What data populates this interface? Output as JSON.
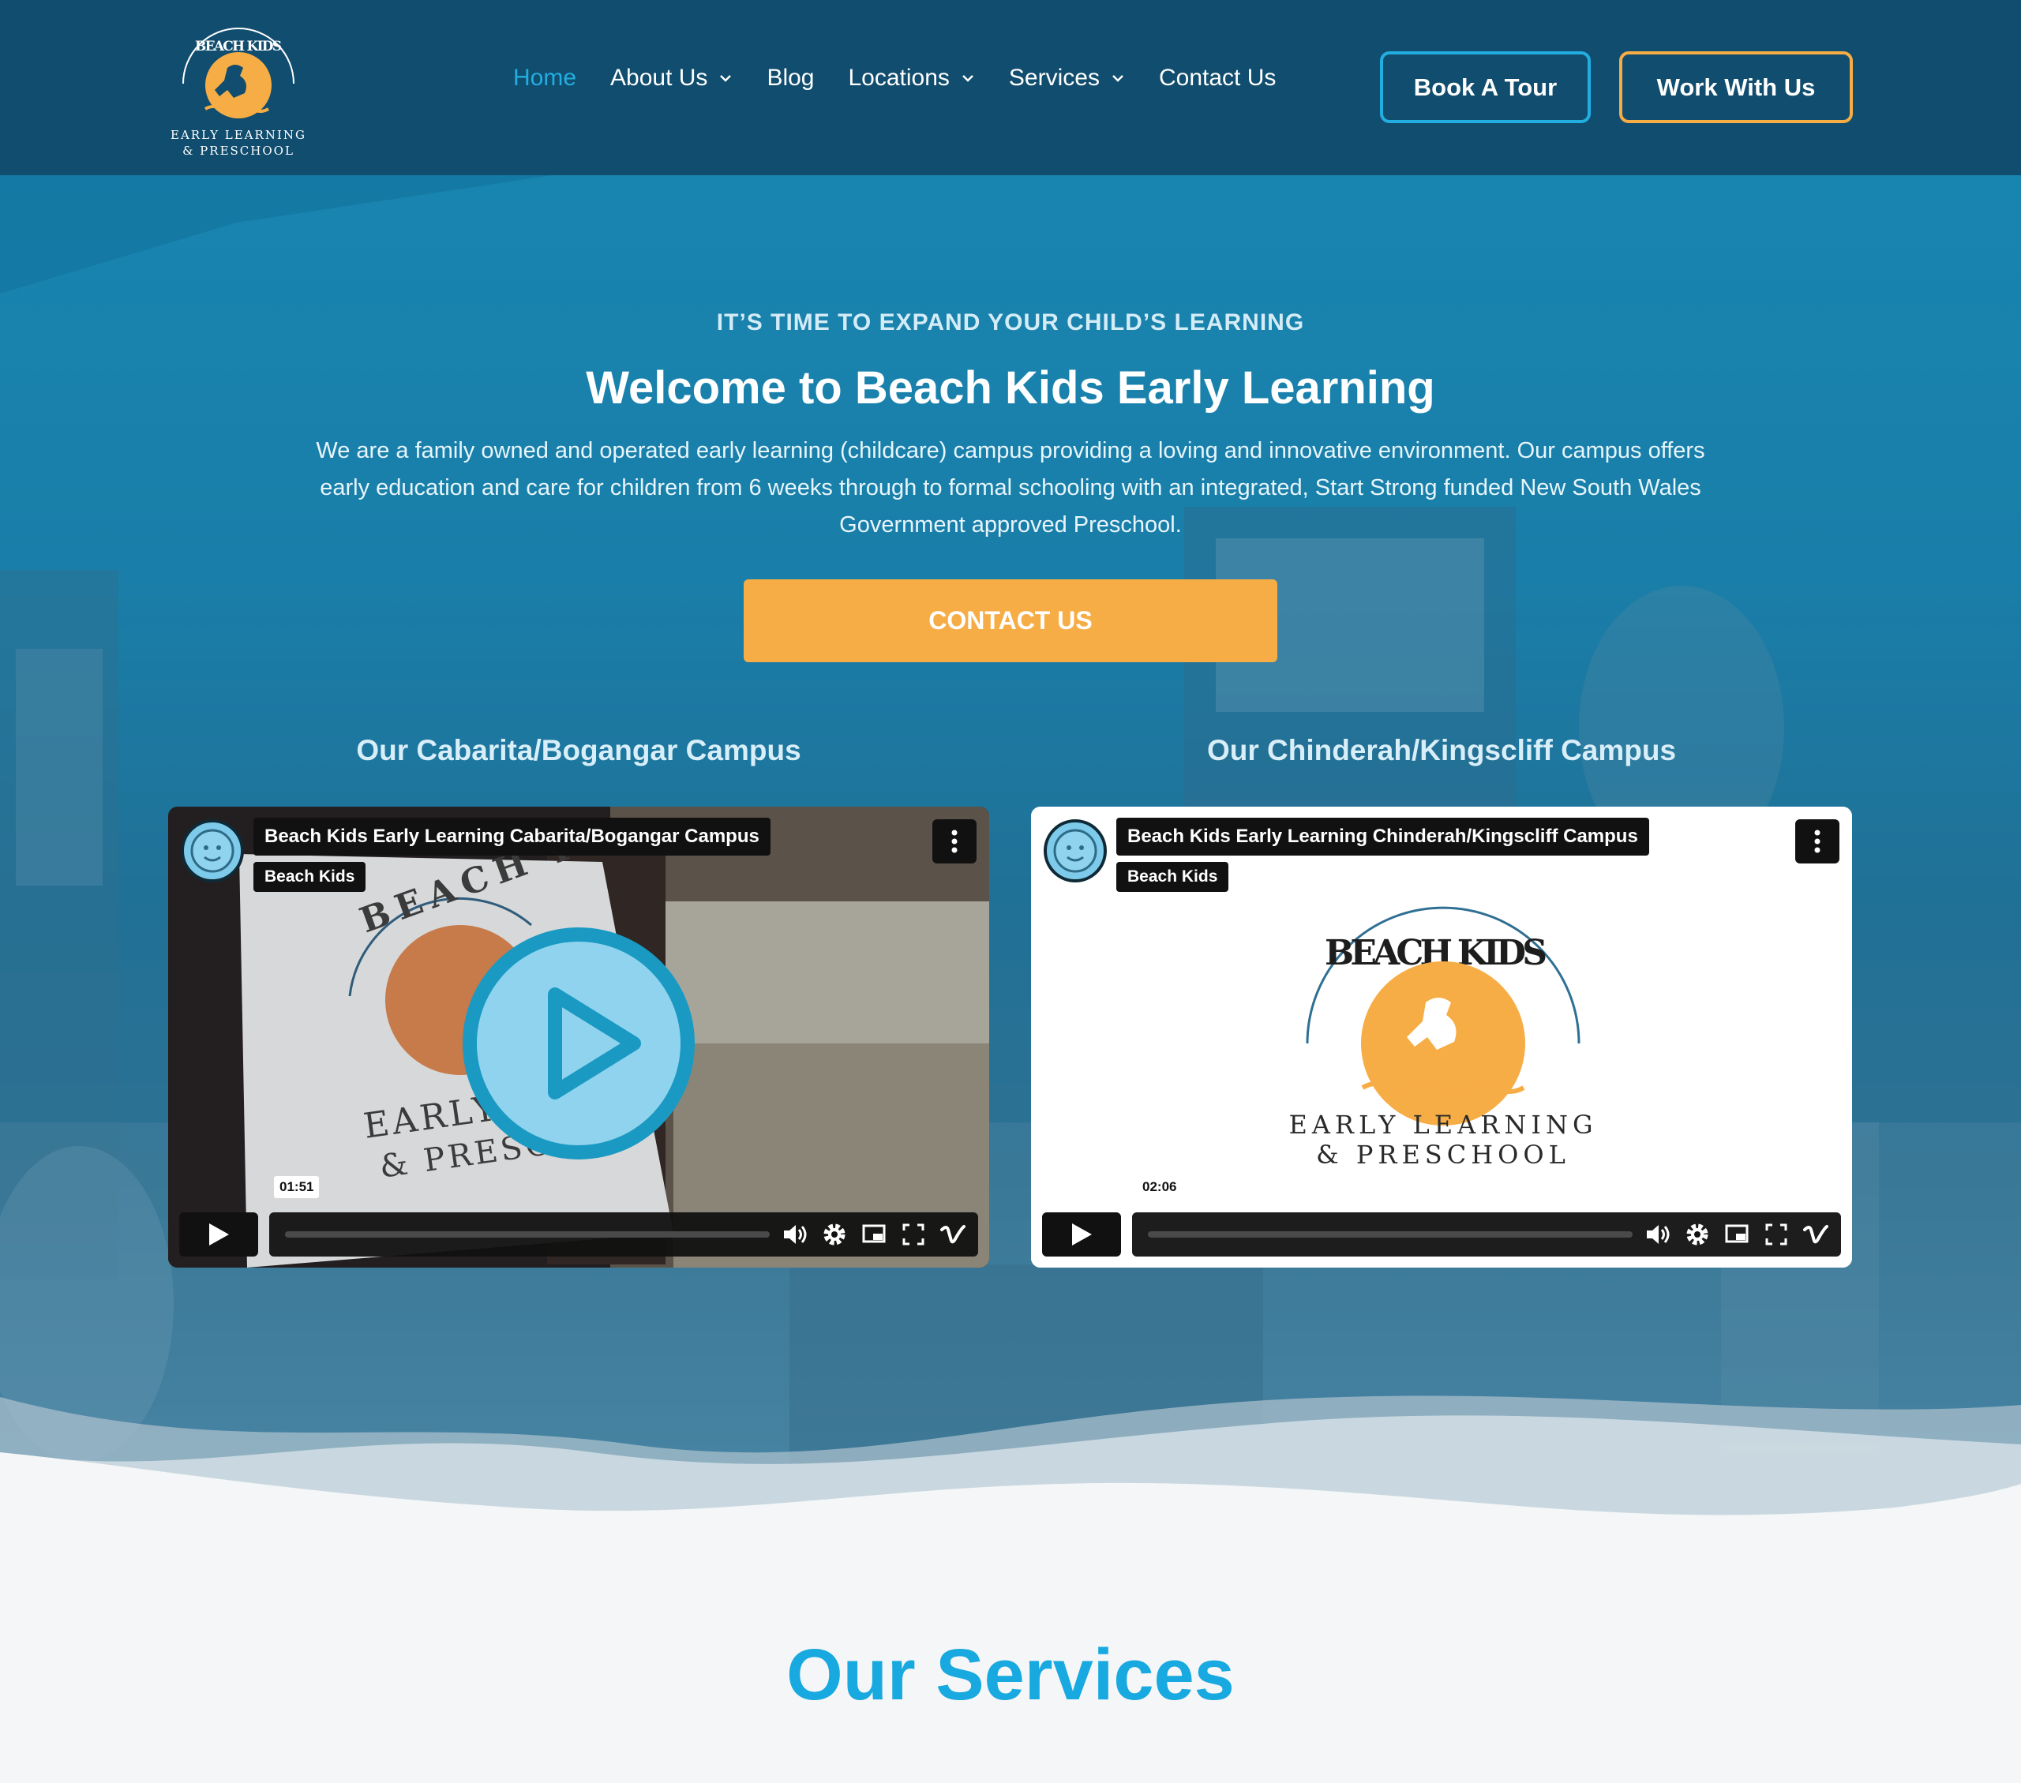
{
  "header": {
    "logo": {
      "arc_text": "BEACH KIDS",
      "line1": "EARLY LEARNING",
      "line2": "& PRESCHOOL"
    },
    "nav": [
      {
        "label": "Home",
        "active": true,
        "dropdown": false
      },
      {
        "label": "About Us",
        "active": false,
        "dropdown": true
      },
      {
        "label": "Blog",
        "active": false,
        "dropdown": false
      },
      {
        "label": "Locations",
        "active": false,
        "dropdown": true
      },
      {
        "label": "Services",
        "active": false,
        "dropdown": true
      },
      {
        "label": "Contact Us",
        "active": false,
        "dropdown": false
      }
    ],
    "book_tour_label": "Book A Tour",
    "work_with_us_label": "Work With Us"
  },
  "hero": {
    "eyebrow": "IT’S TIME TO EXPAND YOUR CHILD’S LEARNING",
    "title": "Welcome to Beach Kids Early Learning",
    "description": "We are a family owned and operated early learning (childcare) campus providing a loving and innovative environment. Our campus offers early education and care for children from 6 weeks through to formal schooling with an integrated, Start Strong funded New South Wales Government approved Preschool.",
    "cta_label": "CONTACT US"
  },
  "campuses": [
    {
      "heading": "Our Cabarita/Bogangar Campus",
      "video_title": "Beach Kids Early Learning Cabarita/Bogangar Campus",
      "channel": "Beach Kids",
      "duration": "01:51",
      "sign_text_1": "EARLY LE",
      "sign_text_2": "& PRESCH",
      "sign_arc": "BEACH KI"
    },
    {
      "heading": "Our Chinderah/Kingscliff Campus",
      "video_title": "Beach Kids Early Learning Chinderah/Kingscliff Campus",
      "channel": "Beach Kids",
      "duration": "02:06",
      "logo_line1": "EARLY LEARNING",
      "logo_line2": "& PRESCHOOL",
      "logo_arc": "BEACH KIDS"
    }
  ],
  "services": {
    "title": "Our Services"
  },
  "icons": {
    "chevron": "chevron-down-icon",
    "play": "play-icon",
    "volume": "volume-icon",
    "settings": "gear-icon",
    "pip": "picture-in-picture-icon",
    "fullscreen": "fullscreen-icon",
    "vimeo": "vimeo-icon",
    "menu": "more-vertical-icon"
  },
  "colors": {
    "header_bg": "#114d6e",
    "accent_blue": "#22aee0",
    "accent_orange": "#f7ad45",
    "services_title": "#17a9df"
  }
}
